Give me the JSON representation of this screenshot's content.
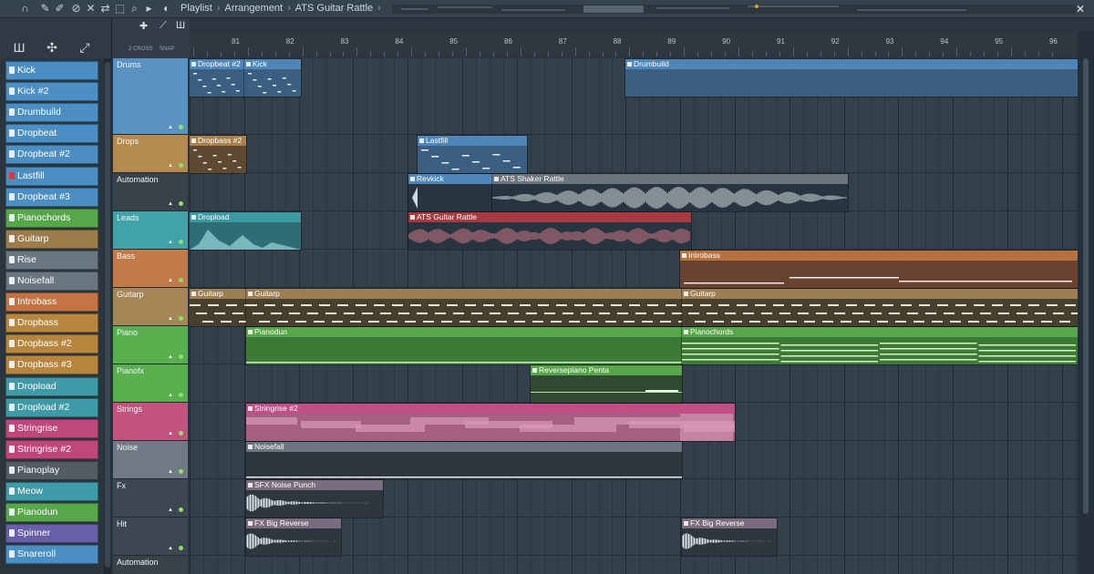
{
  "window": {
    "breadcrumb": [
      "Playlist",
      "Arrangement",
      "ATS Guitar Rattle"
    ],
    "crumb_sep": "›",
    "close_glyph": "✕"
  },
  "toolbar_icons": [
    "magnet-icon",
    "draw-icon",
    "paint-icon",
    "delete-icon",
    "mute-icon",
    "slip-icon",
    "select-icon",
    "zoom-icon",
    "play-icon"
  ],
  "browser_tools": [
    "piano-icon",
    "step-icon",
    "slide-icon"
  ],
  "patterns": [
    {
      "label": "Kick",
      "color": "#4a8ec4"
    },
    {
      "label": "Kick #2",
      "color": "#4a8ec4"
    },
    {
      "label": "Drumbuild",
      "color": "#4a8ec4"
    },
    {
      "label": "Dropbeat",
      "color": "#4a8ec4"
    },
    {
      "label": "Dropbeat #2",
      "color": "#4a8ec4"
    },
    {
      "label": "Lastfill",
      "color": "#4a8ec4",
      "selected": true
    },
    {
      "label": "Dropbeat #3",
      "color": "#4a8ec4"
    },
    {
      "label": "Pianochords",
      "color": "#56a64a"
    },
    {
      "label": "Guitarp",
      "color": "#9c7b4c"
    },
    {
      "label": "Rise",
      "color": "#6a7680"
    },
    {
      "label": "Noisefall",
      "color": "#6a7680"
    },
    {
      "label": "Introbass",
      "color": "#c47442"
    },
    {
      "label": "Dropbass",
      "color": "#b7853e"
    },
    {
      "label": "Dropbass #2",
      "color": "#b7853e"
    },
    {
      "label": "Dropbass #3",
      "color": "#b7853e"
    },
    {
      "label": "Dropload",
      "color": "#3f9aa8"
    },
    {
      "label": "Dropload #2",
      "color": "#3f9aa8"
    },
    {
      "label": "Stringrise",
      "color": "#c0477c"
    },
    {
      "label": "Stringrise #2",
      "color": "#c0477c"
    },
    {
      "label": "Pianoplay",
      "color": "#525c64"
    },
    {
      "label": "Meow",
      "color": "#3f9aa8"
    },
    {
      "label": "Pianodun",
      "color": "#56a64a"
    },
    {
      "label": "Spinner",
      "color": "#6760a8"
    },
    {
      "label": "Snareroll",
      "color": "#4a8ec4"
    }
  ],
  "ruler": {
    "bars": [
      "81",
      "82",
      "83",
      "84",
      "85",
      "86",
      "87",
      "88",
      "89",
      "90",
      "91",
      "92",
      "93",
      "94",
      "95",
      "96"
    ]
  },
  "zoom_labels": [
    "2 CROSS",
    "SNAP"
  ],
  "tracks": [
    {
      "name": "Drums",
      "color": "#5a92c2"
    },
    {
      "name": "Drops",
      "color": "#b58a4e"
    },
    {
      "name": "Automation",
      "color": "#37424b"
    },
    {
      "name": "Leads",
      "color": "#3fa3a8"
    },
    {
      "name": "Bass",
      "color": "#c27a48"
    },
    {
      "name": "Guitarp",
      "color": "#a58657"
    },
    {
      "name": "Piano",
      "color": "#59ae4e"
    },
    {
      "name": "Pianofx",
      "color": "#59ae4e"
    },
    {
      "name": "Strings",
      "color": "#c4527f"
    },
    {
      "name": "Noise",
      "color": "#6f7a84"
    },
    {
      "name": "Fx",
      "color": "#3c4751"
    },
    {
      "name": "Hit",
      "color": "#3c4751"
    },
    {
      "name": "Automation",
      "color": "#37424b"
    }
  ],
  "clips": [
    {
      "label": "Dropbeat #2",
      "color": "#4e86b8",
      "body": "#3a5f80"
    },
    {
      "label": "Kick",
      "color": "#4e86b8",
      "body": "#3a5f80"
    },
    {
      "label": "Drumbuild",
      "color": "#4e86b8",
      "body": "#3a5f80"
    },
    {
      "label": "Dropbass #2",
      "color": "#a7804c",
      "body": "#5d4a30"
    },
    {
      "label": "Lastfill",
      "color": "#4e86b8",
      "body": "#3a5f80"
    },
    {
      "label": "Revkick",
      "color": "#4e86b8",
      "body": "#283540"
    },
    {
      "label": "ATS Shaker Rattle",
      "color": "#6c747b",
      "body": "#283540"
    },
    {
      "label": "Dropload",
      "color": "#3a9aa2",
      "body": "#2c6e74"
    },
    {
      "label": "ATS Guitar Rattle",
      "color": "#a63a40",
      "body": "#283540"
    },
    {
      "label": "Introbass",
      "color": "#b8703f",
      "body": "#6a4230"
    },
    {
      "label": "Guitarp",
      "color": "#9c7f52",
      "body": "#47402f"
    },
    {
      "label": "Guitarp",
      "color": "#9c7f52",
      "body": "#47402f"
    },
    {
      "label": "Guitarp",
      "color": "#9c7f52",
      "body": "#47402f"
    },
    {
      "label": "Pianodun",
      "color": "#57a64a",
      "body": "#3d7a36"
    },
    {
      "label": "Pianochords",
      "color": "#57a64a",
      "body": "#3d7a36"
    },
    {
      "label": "Reversepiano Penta",
      "color": "#57a64a",
      "body": "#2f4a30"
    },
    {
      "label": "Stringrise #2",
      "color": "#c24e86",
      "body": "#a55f83"
    },
    {
      "label": "Noisefall",
      "color": "#6a7580",
      "body": "#2e3740"
    },
    {
      "label": "SFX Noise Punch",
      "color": "#7a6b7e",
      "body": "#2e3740"
    },
    {
      "label": "FX Big Reverse",
      "color": "#7a6b7e",
      "body": "#2e3740"
    },
    {
      "label": "FX Big Reverse",
      "color": "#7a6b7e",
      "body": "#2e3740"
    }
  ]
}
